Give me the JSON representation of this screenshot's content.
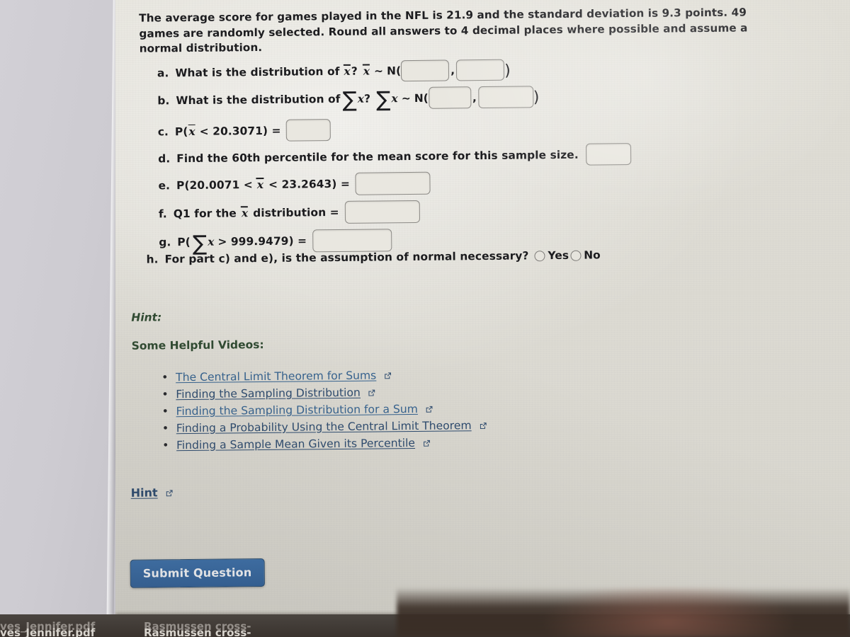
{
  "problem": {
    "intro": "The average score for games played in the NFL is 21.9 and the standard deviation is 9.3 points. 49 games are randomly selected. Round all answers to 4 decimal places where possible and assume a normal distribution.",
    "mean": "21.9",
    "std_dev": "9.3",
    "sample_size": "49",
    "decimal_places": "4"
  },
  "questions": {
    "a": {
      "label": "a.",
      "text_1": "What is the distribution of",
      "var_1": "x",
      "q_mark": "?",
      "var_2": "x",
      "tilde": "~",
      "dist": "N(",
      "comma": ",",
      "close": ")",
      "input_1_value": "",
      "input_2_value": ""
    },
    "b": {
      "label": "b.",
      "text_1": "What is the distribution of",
      "sigma": "∑",
      "var_1": "x",
      "q_mark": "?",
      "var_2": "x",
      "tilde": "~",
      "dist": "N(",
      "comma": ",",
      "close": ")",
      "input_1_value": "",
      "input_2_value": ""
    },
    "c": {
      "label": "c.",
      "prefix": "P(",
      "var": "x",
      "op": "< 20.3071) =",
      "value": "20.3071",
      "input_value": ""
    },
    "d": {
      "label": "d.",
      "text": "Find the 60th percentile for the mean score for this sample size.",
      "percentile": "60",
      "input_value": ""
    },
    "e": {
      "label": "e.",
      "prefix": "P(20.0071 <",
      "var": "x",
      "suffix": "< 23.2643) =",
      "lower": "20.0071",
      "upper": "23.2643",
      "input_value": ""
    },
    "f": {
      "label": "f.",
      "text_1": "Q1 for the",
      "var": "x",
      "text_2": "distribution =",
      "input_value": ""
    },
    "g": {
      "label": "g.",
      "prefix": "P(",
      "sigma": "∑",
      "var": "x",
      "suffix": "> 999.9479) =",
      "value": "999.9479",
      "input_value": ""
    },
    "h": {
      "label": "h.",
      "text": "For part c) and e), is the assumption of normal necessary?",
      "option_yes": "Yes",
      "option_no": "No",
      "selected": ""
    }
  },
  "hint_section": {
    "hint_heading": "Hint:",
    "videos_heading": "Some Helpful Videos:",
    "videos": [
      {
        "label": "The Central Limit Theorem for Sums",
        "icon": "external-link-icon"
      },
      {
        "label": "Finding the Sampling Distribution",
        "icon": "external-link-icon"
      },
      {
        "label": "Finding the Sampling Distribution for a Sum",
        "icon": "external-link-icon"
      },
      {
        "label": "Finding a Probability Using the Central Limit Theorem",
        "icon": "external-link-icon"
      },
      {
        "label": "Finding a Sample Mean Given its Percentile",
        "icon": "external-link-icon"
      }
    ],
    "hint_link": "Hint",
    "hint_link_icon": "external-link-icon"
  },
  "actions": {
    "submit_label": "Submit Question"
  },
  "taskbar": {
    "items": [
      {
        "label": "ves_Jennifer.pdf"
      },
      {
        "label": "Rasmussen cross-"
      }
    ]
  },
  "colors": {
    "link": "#2c4a6e",
    "link_alt": "#35628f",
    "heading_green": "#2f4a31",
    "submit_blue": "#2f5f97",
    "page_bg": "#dedcd4",
    "panel_bg": "#cfcdd3",
    "taskbar_bg": "#3a332e"
  }
}
